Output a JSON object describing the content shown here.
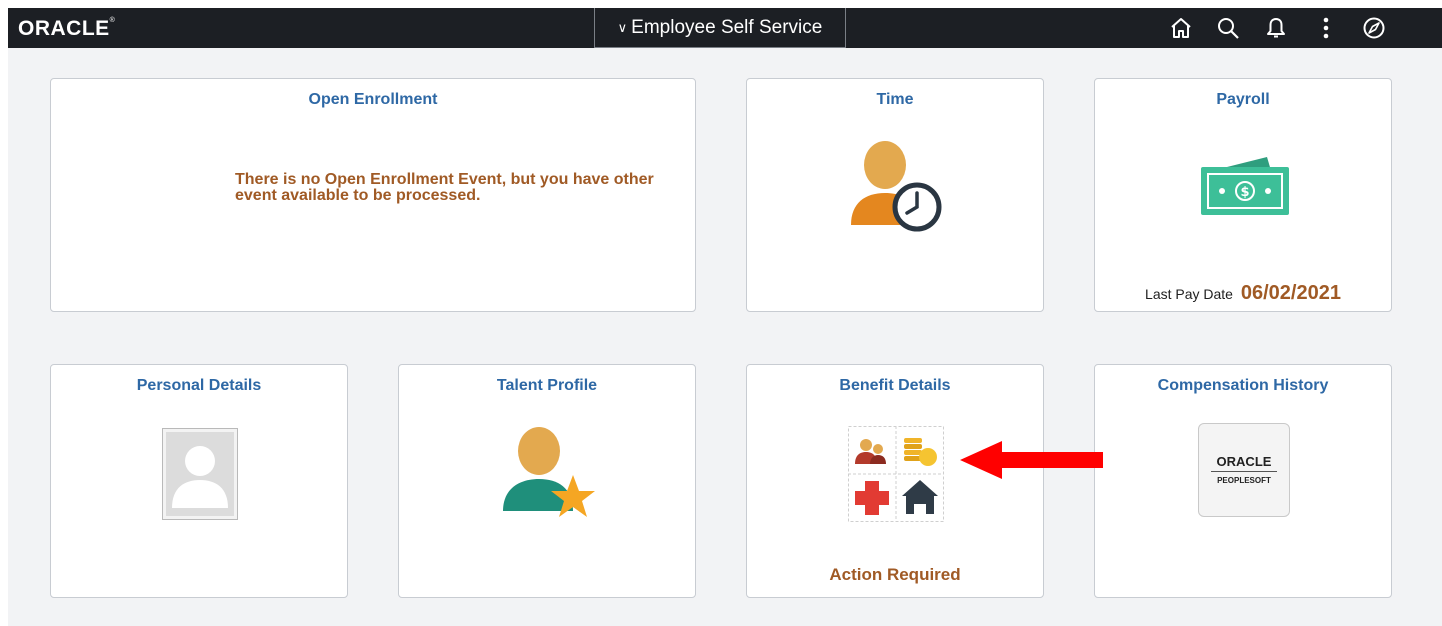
{
  "header": {
    "logo": "ORACLE",
    "homepage_selector": "Employee Self Service",
    "icons": [
      "home-icon",
      "search-icon",
      "notifications-icon",
      "actions-menu-icon",
      "navbar-icon"
    ]
  },
  "tiles": {
    "open_enrollment": {
      "title": "Open Enrollment",
      "message": "There is no Open Enrollment Event, but you have other event available to be processed."
    },
    "time": {
      "title": "Time",
      "icon": "person-clock-icon"
    },
    "payroll": {
      "title": "Payroll",
      "icon": "money-icon",
      "last_pay_label": "Last Pay Date",
      "last_pay_date": "06/02/2021"
    },
    "personal_details": {
      "title": "Personal Details",
      "icon": "person-photo-placeholder-icon"
    },
    "talent_profile": {
      "title": "Talent Profile",
      "icon": "person-star-icon"
    },
    "benefit_details": {
      "title": "Benefit Details",
      "icon": "benefits-grid-icon",
      "status": "Action Required"
    },
    "compensation_history": {
      "title": "Compensation History",
      "logo_top": "ORACLE",
      "logo_bottom": "PEOPLESOFT"
    }
  },
  "annotation": {
    "arrow_color": "#ff0000"
  },
  "colors": {
    "header_bg": "#1c1f24",
    "tile_title": "#2e68a5",
    "accent_text": "#a05a25"
  }
}
